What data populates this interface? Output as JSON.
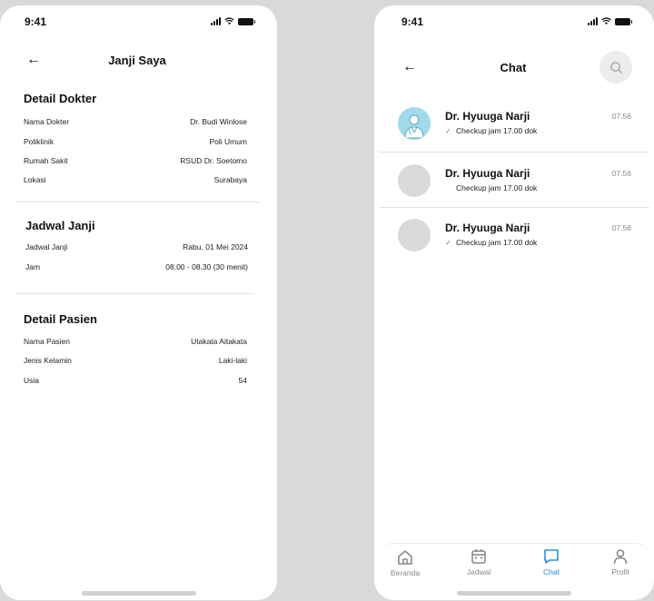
{
  "left_screen": {
    "status_time": "9:41",
    "header": {
      "title": "Janji Saya"
    },
    "doctor_section": {
      "title": "Detail Dokter",
      "rows": [
        {
          "label": "Nama Dokter",
          "value": "Dr. Budi Winlose"
        },
        {
          "label": "Poliklinik",
          "value": "Poli Umum"
        },
        {
          "label": "Rumah Sakit",
          "value": "RSUD Dr. Soetomo"
        },
        {
          "label": "Lokasi",
          "value": "Surabaya"
        }
      ]
    },
    "schedule_section": {
      "title": "Jadwal Janji",
      "rows": [
        {
          "label": "Jadwal Janji",
          "value": "Rabu, 01 Mei 2024"
        },
        {
          "label": "Jam",
          "value": "08.00 - 08.30 (30 menit)"
        }
      ]
    },
    "patient_section": {
      "title": "Detail Pasien",
      "rows": [
        {
          "label": "Nama Pasien",
          "value": "Utakata Aitakata"
        },
        {
          "label": "Jenis Kelamin",
          "value": "Laki-laki"
        },
        {
          "label": "Usia",
          "value": "54"
        }
      ]
    }
  },
  "right_screen": {
    "status_time": "9:41",
    "header": {
      "title": "Chat"
    },
    "chats": [
      {
        "name": "Dr. Hyuuga Narji",
        "message": "Checkup jam 17.00 dok",
        "time": "07.56",
        "read": true,
        "avatar": "doctor-avatar"
      },
      {
        "name": "Dr. Hyuuga Narji",
        "message": "Checkup jam 17.00 dok",
        "time": "07.56",
        "read": false,
        "avatar": "placeholder"
      },
      {
        "name": "Dr. Hyuuga Narji",
        "message": "Checkup jam 17.00 dok",
        "time": "07.56",
        "read": true,
        "avatar": "placeholder"
      }
    ],
    "nav": [
      {
        "label": "Beranda",
        "icon": "home-icon",
        "active": false
      },
      {
        "label": "Jadwal",
        "icon": "calendar-icon",
        "active": false
      },
      {
        "label": "Chat",
        "icon": "chat-icon",
        "active": true
      },
      {
        "label": "Profil",
        "icon": "profile-icon",
        "active": false
      }
    ]
  },
  "colors": {
    "accent": "#2a8de0",
    "avatar_blue": "#9fdbea",
    "placeholder": "#d9d9d9",
    "background": "#d9d9d9"
  }
}
